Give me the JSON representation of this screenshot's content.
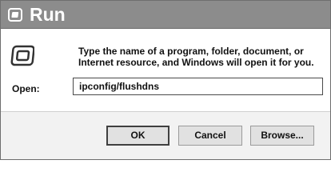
{
  "window": {
    "title": "Run",
    "title_icon": "run-app-icon"
  },
  "content": {
    "icon": "run-app-icon",
    "description": "Type the name of a program, folder, document, or Internet resource, and Windows will open it for you.",
    "open_label": "Open:",
    "open_value": "ipconfig/flushdns"
  },
  "buttons": {
    "ok": "OK",
    "cancel": "Cancel",
    "browse": "Browse..."
  },
  "colors": {
    "titlebar": "#8c8c8c",
    "footer": "#f2f2f2",
    "button": "#e1e1e1"
  }
}
